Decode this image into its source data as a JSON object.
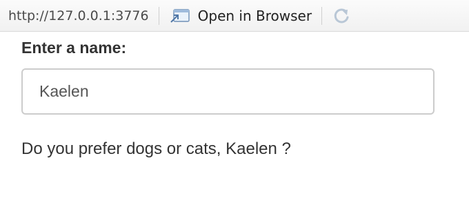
{
  "toolbar": {
    "url": "http://127.0.0.1:3776",
    "open_in_browser_label": "Open in Browser",
    "open_icon": "external-window-icon",
    "refresh_icon": "refresh-icon"
  },
  "form": {
    "name_label": "Enter a name:",
    "name_value": "Kaelen"
  },
  "output": {
    "message": "Do you prefer dogs or cats, Kaelen ?"
  }
}
